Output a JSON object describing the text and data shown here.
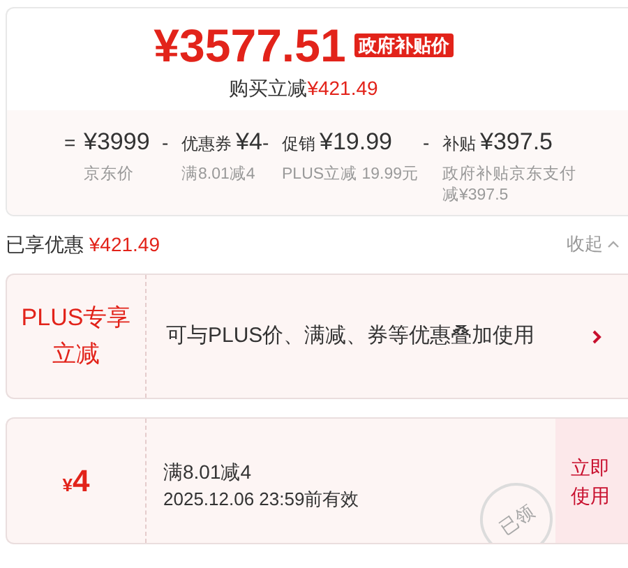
{
  "price": {
    "amount": "¥3577.51",
    "badge": "政府补贴价",
    "subtitle_label": "购买立减",
    "subtitle_amount": "¥421.49"
  },
  "breakdown": [
    {
      "operator": "=",
      "amount": "¥3999",
      "note": "京东价"
    },
    {
      "operator": "-",
      "label": "优惠券",
      "amount": "¥4",
      "note": "满8.01减4"
    },
    {
      "operator": "-",
      "label": "促销",
      "amount": "¥19.99",
      "note": "PLUS立减 19.99元"
    },
    {
      "operator": "-",
      "label": "补贴",
      "amount": "¥397.5",
      "note": "政府补贴京东支付减¥397.5"
    }
  ],
  "savings": {
    "label": "已享优惠",
    "amount": "¥421.49",
    "collapse": "收起"
  },
  "offers": [
    {
      "kind": "plus",
      "title": "PLUS专享立减",
      "description": "可与PLUS价、满减、券等优惠叠加使用"
    },
    {
      "kind": "coupon",
      "currency": "¥",
      "value": "4",
      "condition": "满8.01减4",
      "expiry": "2025.12.06 23:59前有效",
      "action": "立即使用",
      "stamp": "已领"
    }
  ]
}
